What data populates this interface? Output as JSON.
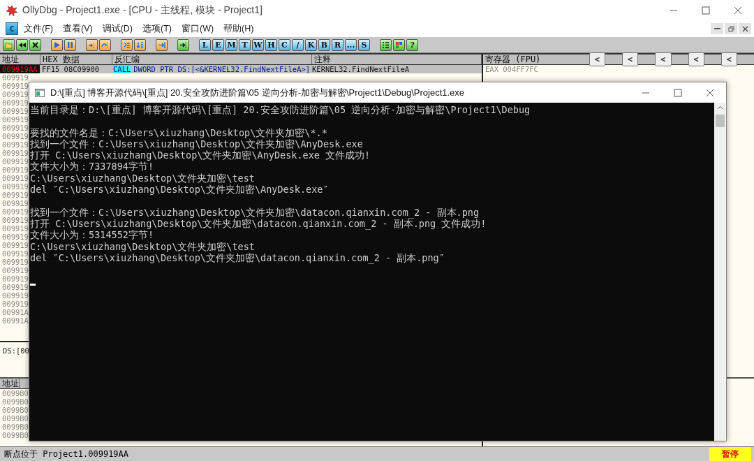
{
  "window": {
    "title": "OllyDbg - Project1.exe - [CPU - 主线程, 模块 - Project1]"
  },
  "menu_bar": {
    "system_icon": "C",
    "items": [
      "文件(F)",
      "查看(V)",
      "调试(D)",
      "选项(T)",
      "窗口(W)",
      "帮助(H)"
    ]
  },
  "toolbar": {
    "letter_buttons": [
      "L",
      "E",
      "M",
      "T",
      "W",
      "H",
      "C",
      "/",
      "K",
      "B",
      "R",
      "...",
      "S"
    ],
    "help_button": "?"
  },
  "cpu": {
    "columns": [
      "地址",
      "HEX 数据",
      "反汇编",
      "注释"
    ],
    "rows": [
      {
        "address": "009919AA",
        "hex": "FF15 08C09900",
        "mnemonic": "CALL",
        "operand": "DWORD PTR DS:[<&KERNEL32.FindNextFileA>]",
        "comment": "KERNEL32.FindNextFileA",
        "selected": true
      },
      {
        "address": "009919",
        "selected": false
      },
      {
        "address": "009919",
        "selected": false
      },
      {
        "address": "009919",
        "selected": false
      },
      {
        "address": "009919",
        "selected": false
      },
      {
        "address": "009919",
        "selected": false
      },
      {
        "address": "009919",
        "selected": false
      },
      {
        "address": "009919",
        "selected": false
      },
      {
        "address": "009919",
        "selected": false
      },
      {
        "address": "009919",
        "selected": false
      },
      {
        "address": "009919",
        "selected": false
      },
      {
        "address": "009919",
        "selected": false
      },
      {
        "address": "009919",
        "selected": false
      },
      {
        "address": "009919",
        "selected": false
      },
      {
        "address": "009919",
        "selected": false
      },
      {
        "address": "009919",
        "selected": false
      },
      {
        "address": "009919",
        "selected": false
      },
      {
        "address": "009919",
        "selected": false
      },
      {
        "address": "009919",
        "selected": false
      },
      {
        "address": "009919",
        "selected": false
      },
      {
        "address": "009919",
        "selected": false
      },
      {
        "address": "009919",
        "selected": false
      },
      {
        "address": "009919",
        "selected": false
      },
      {
        "address": "009919",
        "selected": false
      },
      {
        "address": "009919",
        "selected": false
      },
      {
        "address": "009919",
        "selected": false
      },
      {
        "address": "009919",
        "selected": false
      },
      {
        "address": "009919",
        "selected": false
      },
      {
        "address": "009919",
        "selected": false
      },
      {
        "address": "00991A",
        "selected": false
      },
      {
        "address": "00991A",
        "selected": false
      }
    ]
  },
  "registers": {
    "title": "寄存器 (FPU)",
    "arrows": [
      "<",
      "<",
      "<",
      "<",
      "<"
    ],
    "lines": [
      "EAX 004FF7FC"
    ]
  },
  "info_pane": {
    "text": "DS:[00"
  },
  "dump": {
    "column": "地址",
    "rows": [
      "0099B0",
      "0099B0",
      "0099B0",
      "0099B0",
      "0099B0",
      "0099B0"
    ]
  },
  "status_bar": {
    "text": "断点位于 Project1.009919AA",
    "state": "暂停"
  },
  "console": {
    "title": "D:\\[重点] 博客开源代码\\[重点] 20.安全攻防进阶篇\\05 逆向分析-加密与解密\\Project1\\Debug\\Project1.exe",
    "cursor": true,
    "lines": [
      {
        "kind": "text",
        "text": "当前目录是：D:\\[重点] 博客开源代码\\[重点] 20.安全攻防进阶篇\\05 逆向分析-加密与解密\\Project1\\Debug"
      },
      {
        "kind": "blank"
      },
      {
        "kind": "text",
        "text": "要找的文件名是：C:\\Users\\xiuzhang\\Desktop\\文件夹加密\\*.*"
      },
      {
        "kind": "text",
        "text": "找到一个文件：C:\\Users\\xiuzhang\\Desktop\\文件夹加密\\AnyDesk.exe"
      },
      {
        "kind": "text",
        "text": "打开 C:\\Users\\xiuzhang\\Desktop\\文件夹加密\\AnyDesk.exe 文件成功!"
      },
      {
        "kind": "text",
        "text": "文件大小为：7337894字节!"
      },
      {
        "kind": "text",
        "text": "C:\\Users\\xiuzhang\\Desktop\\文件夹加密\\test"
      },
      {
        "kind": "text",
        "text": "del ″C:\\Users\\xiuzhang\\Desktop\\文件夹加密\\AnyDesk.exe″"
      },
      {
        "kind": "blank"
      },
      {
        "kind": "text",
        "text": "找到一个文件：C:\\Users\\xiuzhang\\Desktop\\文件夹加密\\datacon.qianxin.com_2 - 副本.png"
      },
      {
        "kind": "text",
        "text": "打开 C:\\Users\\xiuzhang\\Desktop\\文件夹加密\\datacon.qianxin.com_2 - 副本.png 文件成功!"
      },
      {
        "kind": "text",
        "text": "文件大小为：5314552字节!"
      },
      {
        "kind": "text",
        "text": "C:\\Users\\xiuzhang\\Desktop\\文件夹加密\\test"
      },
      {
        "kind": "text",
        "text": "del ″C:\\Users\\xiuzhang\\Desktop\\文件夹加密\\datacon.qianxin.com_2 - 副本.png″"
      }
    ]
  }
}
